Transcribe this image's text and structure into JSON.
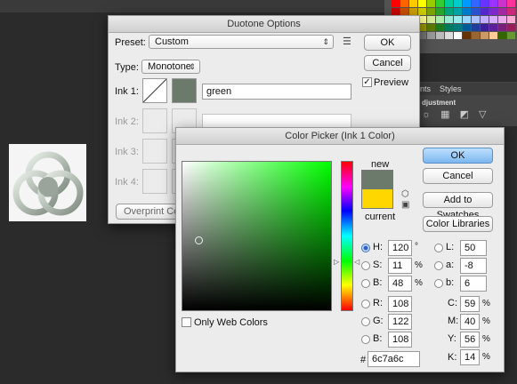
{
  "swatch_colors": [
    "#ff0000",
    "#ff6600",
    "#ffcc00",
    "#ffff00",
    "#99cc00",
    "#33cc33",
    "#00cc99",
    "#00cccc",
    "#0099ff",
    "#3366ff",
    "#6633ff",
    "#9933ff",
    "#cc33cc",
    "#ff3399",
    "#cc0000",
    "#cc5200",
    "#cca300",
    "#cccc00",
    "#7aa300",
    "#29a329",
    "#00a37a",
    "#00a3a3",
    "#007acc",
    "#2952cc",
    "#5229cc",
    "#7a29cc",
    "#a329a3",
    "#cc297a",
    "#ff9999",
    "#ffc299",
    "#ffe699",
    "#ffff99",
    "#d6eb99",
    "#adebad",
    "#99ebd6",
    "#99ebeb",
    "#99d6ff",
    "#adc2ff",
    "#c2adff",
    "#d6adff",
    "#ebadeb",
    "#ffadd6",
    "#990000",
    "#993d00",
    "#997a00",
    "#999900",
    "#5c7a00",
    "#1f7a1f",
    "#007a5c",
    "#007a7a",
    "#005c99",
    "#1f3d99",
    "#3d1f99",
    "#5c1f99",
    "#7a1f7a",
    "#991f5c",
    "#000000",
    "#333333",
    "#555555",
    "#777777",
    "#999999",
    "#bbbbbb",
    "#dddddd",
    "#ffffff",
    "#663300",
    "#996633",
    "#cc9966",
    "#ffcc99",
    "#336600",
    "#669933"
  ],
  "adjustments_panel": {
    "tab_styles": "Styles",
    "tab_partial": "nts",
    "title": "djustment"
  },
  "duotone": {
    "title": "Duotone Options",
    "preset_label": "Preset:",
    "preset_value": "Custom",
    "type_label": "Type:",
    "type_value": "Monotone",
    "ink1_label": "Ink 1:",
    "ink1_name": "green",
    "ink1_color": "#6c7a6c",
    "ink2_label": "Ink 2:",
    "ink3_label": "Ink 3:",
    "ink4_label": "Ink 4:",
    "overprint_label": "Overprint Colo",
    "ok_label": "OK",
    "cancel_label": "Cancel",
    "preview_label": "Preview",
    "preview_checked": true
  },
  "picker": {
    "title": "Color Picker (Ink 1 Color)",
    "new_label": "new",
    "current_label": "current",
    "new_color": "#6c7a6c",
    "current_color": "#ffd700",
    "hue_color": "#00ff00",
    "only_web_label": "Only Web Colors",
    "ok_label": "OK",
    "cancel_label": "Cancel",
    "add_swatches_label": "Add to Swatches",
    "color_libraries_label": "Color Libraries",
    "h_label": "H:",
    "h_value": "120",
    "h_unit": "°",
    "s_label": "S:",
    "s_value": "11",
    "s_unit": "%",
    "b_label": "B:",
    "b_value": "48",
    "b_unit": "%",
    "r_label": "R:",
    "r_value": "108",
    "g_label": "G:",
    "g_value": "122",
    "bb_label": "B:",
    "bb_value": "108",
    "l_label": "L:",
    "l_value": "50",
    "a_label": "a:",
    "a_value": "-8",
    "lb_label": "b:",
    "lb_value": "6",
    "c_label": "C:",
    "c_value": "59",
    "c_unit": "%",
    "m_label": "M:",
    "m_value": "40",
    "m_unit": "%",
    "y_label": "Y:",
    "y_value": "56",
    "y_unit": "%",
    "k_label": "K:",
    "k_value": "14",
    "k_unit": "%",
    "hex_label": "#",
    "hex_value": "6c7a6c"
  }
}
